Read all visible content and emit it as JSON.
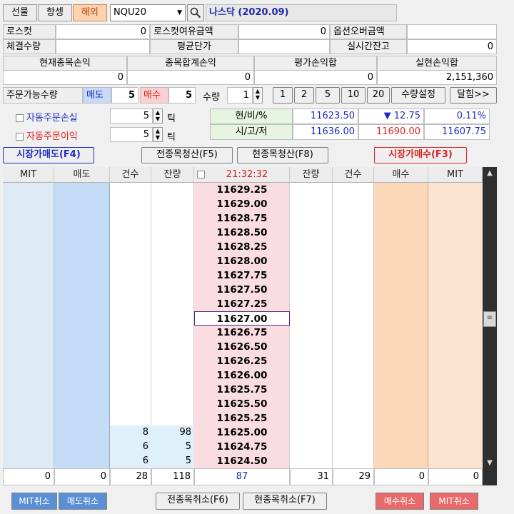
{
  "tabs": [
    {
      "label": "선물",
      "active": false
    },
    {
      "label": "항셍",
      "active": false
    },
    {
      "label": "해외",
      "active": true
    }
  ],
  "symbol": {
    "code": "NQU20",
    "title": "나스닥 (2020.09)"
  },
  "summary": {
    "loss_cut_label": "로스컷",
    "loss_cut_value": "0",
    "loss_cut_margin_label": "로스컷여유금액",
    "loss_cut_margin_value": "0",
    "option_over_label": "옵션오버금액",
    "option_over_value": "",
    "fill_qty_label": "체결수량",
    "fill_qty_value": "",
    "avg_price_label": "평균단가",
    "avg_price_value": "",
    "realtime_balance_label": "실시간잔고",
    "realtime_balance_value": "0"
  },
  "pnl": {
    "headers": [
      "현재종목손익",
      "종목합계손익",
      "평가손익합",
      "실현손익합"
    ],
    "values": [
      "0",
      "0",
      "0",
      "2,151,360"
    ]
  },
  "order": {
    "available_label": "주문가능수량",
    "sell_label": "매도",
    "sell_qty": "5",
    "buy_label": "매수",
    "buy_qty": "5",
    "qty_label": "수량",
    "qty_value": "1",
    "qty_buttons": [
      "1",
      "2",
      "5",
      "10",
      "20"
    ],
    "qty_setting": "수량설정",
    "jump": "달힘>>"
  },
  "auto": {
    "loss_label": "자동주문손실",
    "loss_value": "5",
    "loss_unit": "틱",
    "profit_label": "자동주문이익",
    "profit_value": "5",
    "profit_unit": "틱"
  },
  "quote": {
    "row1_label": "현/비/%",
    "current": "11623.50",
    "change": "12.75",
    "change_arrow": "▼",
    "pct": "0.11%",
    "row2_label": "시/고/저",
    "open": "11636.00",
    "high": "11690.00",
    "low": "11607.75"
  },
  "actions": {
    "market_sell": "시장가매도(F4)",
    "close_all": "전종목청산(F5)",
    "close_current": "현종목청산(F8)",
    "market_buy": "시장가매수(F3)"
  },
  "grid": {
    "headers": [
      "MIT",
      "매도",
      "건수",
      "잔량",
      "21:32:32",
      "잔량",
      "건수",
      "매수",
      "MIT"
    ],
    "prices": [
      "11629.25",
      "11629.00",
      "11628.75",
      "11628.50",
      "11628.25",
      "11628.00",
      "11627.75",
      "11627.50",
      "11627.25",
      "11627.00",
      "11626.75",
      "11626.50",
      "11626.25",
      "11626.00",
      "11625.75",
      "11625.50",
      "11625.25",
      "11625.00",
      "11624.75",
      "11624.50"
    ],
    "bid_rows": [
      {
        "count": "8",
        "qty": "98"
      },
      {
        "count": "6",
        "qty": "5"
      },
      {
        "count": "6",
        "qty": "5"
      }
    ],
    "footer": [
      "0",
      "0",
      "28",
      "118",
      "87",
      "31",
      "29",
      "0",
      "0"
    ]
  },
  "bottom": {
    "mit_cancel_left": "MIT취소",
    "sell_cancel": "매도취소",
    "cancel_all": "전종목취소(F6)",
    "cancel_current": "현종목취소(F7)",
    "buy_cancel": "매수취소",
    "mit_cancel_right": "MIT취소"
  },
  "colors": {
    "ask_bg": "#c4dcf5",
    "ask_mit_bg": "#ddeaf6",
    "bid_bg": "#fbd8b8",
    "price_bg": "#fadde0",
    "buy_red": "#e53a3a",
    "sell_blue": "#1c2cbf"
  }
}
